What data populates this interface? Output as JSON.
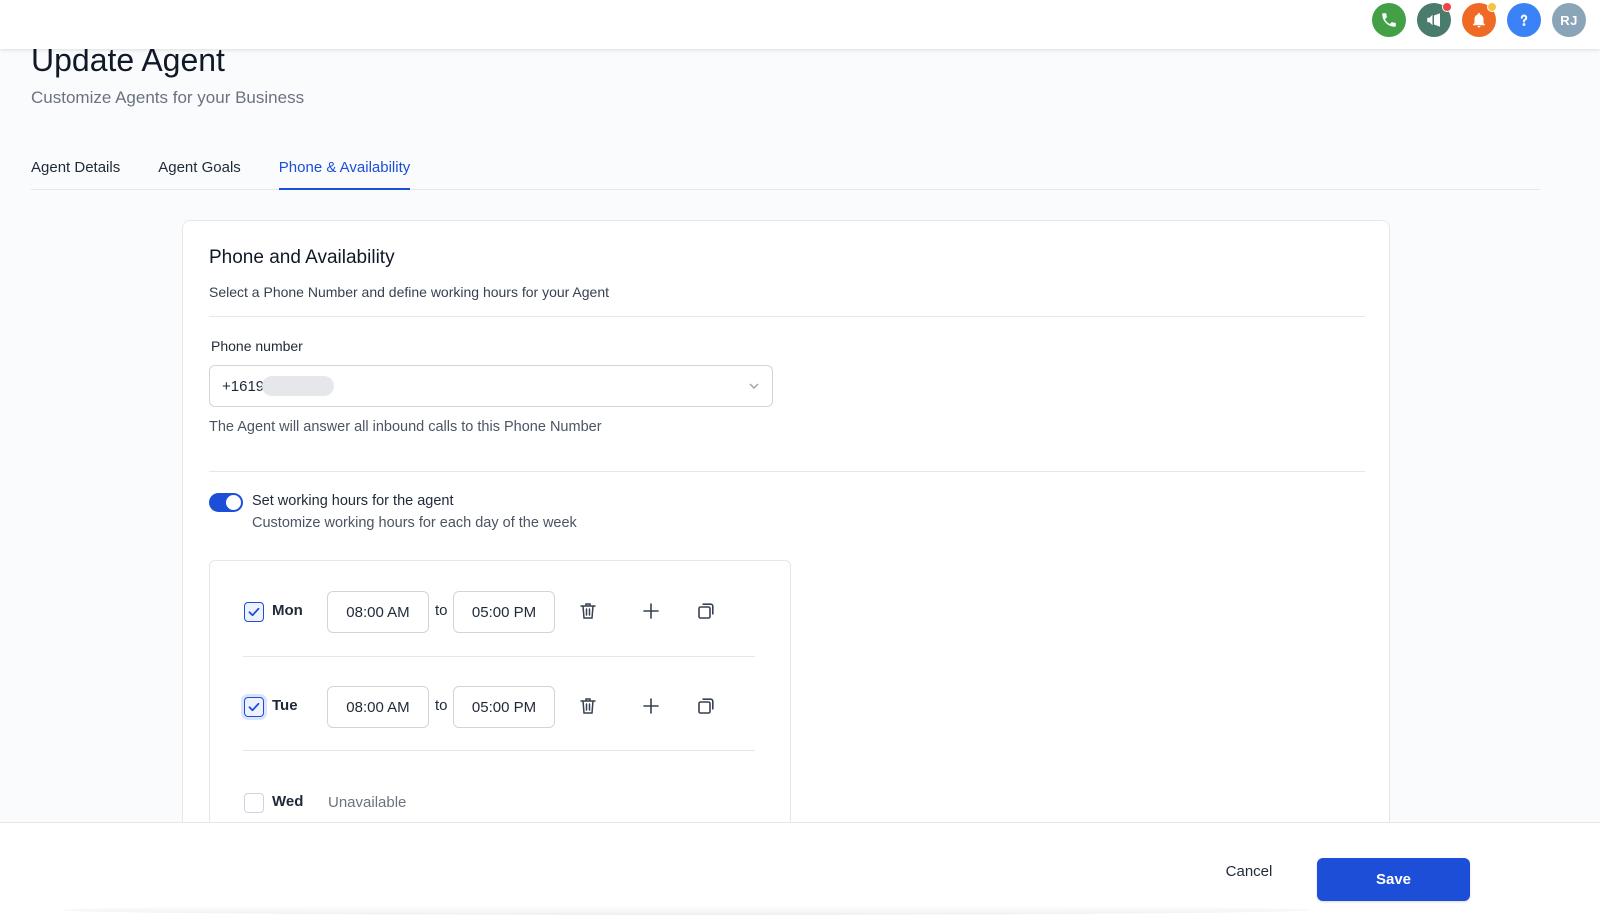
{
  "colors": {
    "accent": "#1d4ed8",
    "phone_icon": "#43a047",
    "announce_icon": "#4a7c6d",
    "notify_icon": "#f06a25",
    "help_icon": "#3b82f6",
    "avatar_bg": "#8aa4b8",
    "badge_red": "#ef4444",
    "badge_yellow": "#f6c343"
  },
  "topbar": {
    "icons": [
      "phone-icon",
      "megaphone-icon",
      "bell-icon",
      "help-icon"
    ],
    "avatar_initials": "RJ"
  },
  "header": {
    "title": "Update Agent",
    "subtitle": "Customize Agents for your Business"
  },
  "tabs": [
    {
      "label": "Agent Details",
      "active": false
    },
    {
      "label": "Agent Goals",
      "active": false
    },
    {
      "label": "Phone & Availability",
      "active": true
    }
  ],
  "card": {
    "title": "Phone and Availability",
    "description": "Select a Phone Number and define working hours for your Agent",
    "phone_label": "Phone number",
    "phone_value": "+1619",
    "phone_helper": "The Agent will answer all inbound calls to this Phone Number",
    "toggle_on": true,
    "toggle_label": "Set working hours for the agent",
    "toggle_desc": "Customize working hours for each day of the week",
    "to_label": "to",
    "unavailable_label": "Unavailable",
    "days": [
      {
        "name": "Mon",
        "checked": true,
        "start": "08:00 AM",
        "end": "05:00 PM"
      },
      {
        "name": "Tue",
        "checked": true,
        "start": "08:00 AM",
        "end": "05:00 PM"
      },
      {
        "name": "Wed",
        "checked": false
      }
    ]
  },
  "footer": {
    "cancel_label": "Cancel",
    "save_label": "Save"
  }
}
